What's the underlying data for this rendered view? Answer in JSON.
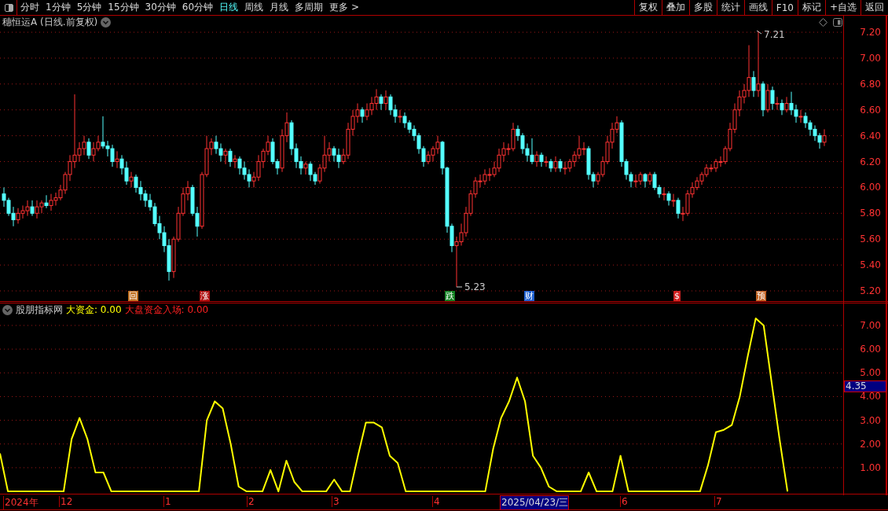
{
  "period_tabs": [
    {
      "label": "分时",
      "selected": false
    },
    {
      "label": "1分钟",
      "selected": false
    },
    {
      "label": "5分钟",
      "selected": false
    },
    {
      "label": "15分钟",
      "selected": false
    },
    {
      "label": "30分钟",
      "selected": false
    },
    {
      "label": "60分钟",
      "selected": false
    },
    {
      "label": "日线",
      "selected": true
    },
    {
      "label": "周线",
      "selected": false
    },
    {
      "label": "月线",
      "selected": false
    },
    {
      "label": "多周期",
      "selected": false
    },
    {
      "label": "更多 >",
      "selected": false
    }
  ],
  "toolbar_buttons": [
    "复权",
    "叠加",
    "多股",
    "统计",
    "画线",
    "F10",
    "标记",
    "+自选",
    "返回"
  ],
  "price_panel": {
    "title": "穗恒运A (日线.前复权)",
    "high_label": "7.21",
    "low_label": "5.23",
    "markers": [
      {
        "text": "回",
        "color": "#c07020"
      },
      {
        "text": "涨",
        "color": "#b01010"
      },
      {
        "text": "跌",
        "color": "#108020"
      },
      {
        "text": "财",
        "color": "#2060d0"
      },
      {
        "text": "$",
        "color": "#d02020"
      },
      {
        "text": "预",
        "color": "#c06020"
      }
    ],
    "chart_data": {
      "type": "candlestick",
      "grid": true,
      "ylim": [
        5.115,
        7.334
      ],
      "yticks": [
        {
          "value": 7.2,
          "label": "7.20"
        },
        {
          "value": 7.0,
          "label": "7.00"
        },
        {
          "value": 6.8,
          "label": "6.80"
        },
        {
          "value": 6.6,
          "label": "6.60"
        },
        {
          "value": 6.4,
          "label": "6.40"
        },
        {
          "value": 6.2,
          "label": "6.20"
        },
        {
          "value": 6.0,
          "label": "6.00"
        },
        {
          "value": 5.8,
          "label": "5.80"
        },
        {
          "value": 5.6,
          "label": "5.60"
        },
        {
          "value": 5.4,
          "label": "5.40"
        },
        {
          "value": 5.2,
          "label": "5.20"
        }
      ],
      "ohlc": [
        [
          5.95,
          6.0,
          5.85,
          5.9
        ],
        [
          5.9,
          5.92,
          5.78,
          5.8
        ],
        [
          5.8,
          5.85,
          5.7,
          5.75
        ],
        [
          5.75,
          5.84,
          5.72,
          5.8
        ],
        [
          5.8,
          5.86,
          5.76,
          5.82
        ],
        [
          5.82,
          5.9,
          5.78,
          5.85
        ],
        [
          5.85,
          5.9,
          5.78,
          5.8
        ],
        [
          5.8,
          5.9,
          5.76,
          5.85
        ],
        [
          5.85,
          5.9,
          5.8,
          5.88
        ],
        [
          5.88,
          5.94,
          5.84,
          5.86
        ],
        [
          5.86,
          5.95,
          5.82,
          5.9
        ],
        [
          5.9,
          5.96,
          5.86,
          5.92
        ],
        [
          5.92,
          6.02,
          5.9,
          5.98
        ],
        [
          5.98,
          6.12,
          5.95,
          6.1
        ],
        [
          6.1,
          6.25,
          6.05,
          6.2
        ],
        [
          6.2,
          6.72,
          6.15,
          6.25
        ],
        [
          6.25,
          6.35,
          6.2,
          6.3
        ],
        [
          6.3,
          6.4,
          6.25,
          6.35
        ],
        [
          6.35,
          6.38,
          6.22,
          6.25
        ],
        [
          6.25,
          6.35,
          6.2,
          6.3
        ],
        [
          6.3,
          6.4,
          6.28,
          6.35
        ],
        [
          6.35,
          6.55,
          6.3,
          6.32
        ],
        [
          6.32,
          6.36,
          6.24,
          6.3
        ],
        [
          6.3,
          6.33,
          6.16,
          6.2
        ],
        [
          6.2,
          6.28,
          6.15,
          6.22
        ],
        [
          6.22,
          6.25,
          6.1,
          6.15
        ],
        [
          6.15,
          6.2,
          6.02,
          6.05
        ],
        [
          6.05,
          6.12,
          6.0,
          6.08
        ],
        [
          6.08,
          6.1,
          5.96,
          6.0
        ],
        [
          6.0,
          6.05,
          5.9,
          5.95
        ],
        [
          5.95,
          5.98,
          5.85,
          5.9
        ],
        [
          5.9,
          5.95,
          5.82,
          5.85
        ],
        [
          5.85,
          5.88,
          5.7,
          5.72
        ],
        [
          5.72,
          5.78,
          5.6,
          5.65
        ],
        [
          5.65,
          5.7,
          5.5,
          5.55
        ],
        [
          5.55,
          5.6,
          5.28,
          5.35
        ],
        [
          5.35,
          5.62,
          5.3,
          5.6
        ],
        [
          5.6,
          5.85,
          5.58,
          5.8
        ],
        [
          5.8,
          6.0,
          5.78,
          5.95
        ],
        [
          5.95,
          6.05,
          5.9,
          6.0
        ],
        [
          6.0,
          6.02,
          5.78,
          5.8
        ],
        [
          5.8,
          5.85,
          5.62,
          5.7
        ],
        [
          5.7,
          6.12,
          5.68,
          6.1
        ],
        [
          6.1,
          6.4,
          6.08,
          6.3
        ],
        [
          6.3,
          6.38,
          6.25,
          6.35
        ],
        [
          6.35,
          6.4,
          6.26,
          6.3
        ],
        [
          6.3,
          6.34,
          6.2,
          6.25
        ],
        [
          6.25,
          6.3,
          6.18,
          6.28
        ],
        [
          6.28,
          6.3,
          6.16,
          6.2
        ],
        [
          6.2,
          6.25,
          6.15,
          6.22
        ],
        [
          6.22,
          6.24,
          6.1,
          6.15
        ],
        [
          6.15,
          6.2,
          6.06,
          6.1
        ],
        [
          6.1,
          6.14,
          6.0,
          6.05
        ],
        [
          6.05,
          6.12,
          6.0,
          6.08
        ],
        [
          6.08,
          6.25,
          6.05,
          6.2
        ],
        [
          6.2,
          6.3,
          6.15,
          6.28
        ],
        [
          6.28,
          6.4,
          6.25,
          6.35
        ],
        [
          6.35,
          6.38,
          6.18,
          6.2
        ],
        [
          6.2,
          6.22,
          6.1,
          6.15
        ],
        [
          6.15,
          6.45,
          6.12,
          6.4
        ],
        [
          6.4,
          6.58,
          6.35,
          6.5
        ],
        [
          6.5,
          6.52,
          6.25,
          6.3
        ],
        [
          6.3,
          6.34,
          6.15,
          6.2
        ],
        [
          6.2,
          6.24,
          6.1,
          6.15
        ],
        [
          6.15,
          6.2,
          6.1,
          6.18
        ],
        [
          6.18,
          6.2,
          6.05,
          6.1
        ],
        [
          6.1,
          6.12,
          6.02,
          6.05
        ],
        [
          6.05,
          6.18,
          6.03,
          6.15
        ],
        [
          6.15,
          6.4,
          6.12,
          6.25
        ],
        [
          6.25,
          6.35,
          6.2,
          6.3
        ],
        [
          6.3,
          6.32,
          6.2,
          6.25
        ],
        [
          6.25,
          6.3,
          6.15,
          6.2
        ],
        [
          6.2,
          6.3,
          6.18,
          6.25
        ],
        [
          6.25,
          6.5,
          6.22,
          6.45
        ],
        [
          6.45,
          6.6,
          6.4,
          6.55
        ],
        [
          6.55,
          6.65,
          6.5,
          6.6
        ],
        [
          6.6,
          6.62,
          6.5,
          6.55
        ],
        [
          6.55,
          6.65,
          6.52,
          6.6
        ],
        [
          6.6,
          6.7,
          6.56,
          6.65
        ],
        [
          6.65,
          6.76,
          6.6,
          6.7
        ],
        [
          6.7,
          6.72,
          6.6,
          6.65
        ],
        [
          6.65,
          6.75,
          6.6,
          6.7
        ],
        [
          6.7,
          6.72,
          6.56,
          6.6
        ],
        [
          6.6,
          6.64,
          6.5,
          6.55
        ],
        [
          6.55,
          6.6,
          6.5,
          6.55
        ],
        [
          6.55,
          6.58,
          6.46,
          6.5
        ],
        [
          6.5,
          6.52,
          6.42,
          6.45
        ],
        [
          6.45,
          6.48,
          6.36,
          6.4
        ],
        [
          6.4,
          6.42,
          6.26,
          6.3
        ],
        [
          6.3,
          6.32,
          6.16,
          6.2
        ],
        [
          6.2,
          6.28,
          6.18,
          6.25
        ],
        [
          6.25,
          6.32,
          6.2,
          6.3
        ],
        [
          6.3,
          6.4,
          6.26,
          6.35
        ],
        [
          6.35,
          6.36,
          6.1,
          6.15
        ],
        [
          6.15,
          6.16,
          5.65,
          5.7
        ],
        [
          5.7,
          5.72,
          5.5,
          5.55
        ],
        [
          5.55,
          5.62,
          5.23,
          5.58
        ],
        [
          5.58,
          5.72,
          5.55,
          5.65
        ],
        [
          5.65,
          5.85,
          5.62,
          5.8
        ],
        [
          5.8,
          5.98,
          5.78,
          5.95
        ],
        [
          5.95,
          6.08,
          5.92,
          6.05
        ],
        [
          6.05,
          6.1,
          6.0,
          6.05
        ],
        [
          6.05,
          6.14,
          6.02,
          6.1
        ],
        [
          6.1,
          6.15,
          6.05,
          6.1
        ],
        [
          6.1,
          6.2,
          6.08,
          6.15
        ],
        [
          6.15,
          6.3,
          6.12,
          6.25
        ],
        [
          6.25,
          6.35,
          6.2,
          6.3
        ],
        [
          6.3,
          6.34,
          6.25,
          6.3
        ],
        [
          6.3,
          6.5,
          6.28,
          6.45
        ],
        [
          6.45,
          6.48,
          6.36,
          6.4
        ],
        [
          6.4,
          6.42,
          6.26,
          6.3
        ],
        [
          6.3,
          6.34,
          6.2,
          6.25
        ],
        [
          6.25,
          6.38,
          6.18,
          6.2
        ],
        [
          6.2,
          6.28,
          6.16,
          6.25
        ],
        [
          6.25,
          6.27,
          6.16,
          6.2
        ],
        [
          6.2,
          6.24,
          6.16,
          6.2
        ],
        [
          6.2,
          6.22,
          6.12,
          6.15
        ],
        [
          6.15,
          6.24,
          6.12,
          6.2
        ],
        [
          6.2,
          6.22,
          6.12,
          6.15
        ],
        [
          6.15,
          6.2,
          6.1,
          6.15
        ],
        [
          6.15,
          6.22,
          6.12,
          6.2
        ],
        [
          6.2,
          6.28,
          6.16,
          6.25
        ],
        [
          6.25,
          6.4,
          6.22,
          6.3
        ],
        [
          6.3,
          6.35,
          6.25,
          6.3
        ],
        [
          6.3,
          6.32,
          6.06,
          6.1
        ],
        [
          6.1,
          6.12,
          6.0,
          6.05
        ],
        [
          6.05,
          6.12,
          6.02,
          6.1
        ],
        [
          6.1,
          6.24,
          6.08,
          6.2
        ],
        [
          6.2,
          6.4,
          6.18,
          6.35
        ],
        [
          6.35,
          6.5,
          6.3,
          6.45
        ],
        [
          6.45,
          6.55,
          6.42,
          6.5
        ],
        [
          6.5,
          6.52,
          6.16,
          6.2
        ],
        [
          6.2,
          6.22,
          6.06,
          6.1
        ],
        [
          6.1,
          6.12,
          6.0,
          6.05
        ],
        [
          6.05,
          6.1,
          6.0,
          6.05
        ],
        [
          6.05,
          6.12,
          6.02,
          6.1
        ],
        [
          6.1,
          6.11,
          6.0,
          6.05
        ],
        [
          6.05,
          6.12,
          6.02,
          6.1
        ],
        [
          6.1,
          6.12,
          5.98,
          6.0
        ],
        [
          6.0,
          6.02,
          5.92,
          5.95
        ],
        [
          5.95,
          6.0,
          5.9,
          5.95
        ],
        [
          5.95,
          5.97,
          5.86,
          5.9
        ],
        [
          5.9,
          5.95,
          5.85,
          5.9
        ],
        [
          5.9,
          5.92,
          5.76,
          5.8
        ],
        [
          5.8,
          5.85,
          5.74,
          5.8
        ],
        [
          5.8,
          5.98,
          5.78,
          5.95
        ],
        [
          5.95,
          6.04,
          5.92,
          6.0
        ],
        [
          6.0,
          6.08,
          5.98,
          6.05
        ],
        [
          6.05,
          6.12,
          6.02,
          6.1
        ],
        [
          6.1,
          6.18,
          6.08,
          6.15
        ],
        [
          6.15,
          6.18,
          6.12,
          6.15
        ],
        [
          6.15,
          6.22,
          6.12,
          6.2
        ],
        [
          6.2,
          6.24,
          6.16,
          6.2
        ],
        [
          6.2,
          6.32,
          6.18,
          6.3
        ],
        [
          6.3,
          6.5,
          6.28,
          6.45
        ],
        [
          6.45,
          6.65,
          6.42,
          6.6
        ],
        [
          6.6,
          6.75,
          6.55,
          6.7
        ],
        [
          6.7,
          6.8,
          6.65,
          6.75
        ],
        [
          6.75,
          7.1,
          6.7,
          6.85
        ],
        [
          6.85,
          6.9,
          6.7,
          6.75
        ],
        [
          6.75,
          7.21,
          6.7,
          6.8
        ],
        [
          6.8,
          6.82,
          6.55,
          6.6
        ],
        [
          6.6,
          6.8,
          6.58,
          6.75
        ],
        [
          6.75,
          6.78,
          6.6,
          6.65
        ],
        [
          6.65,
          6.7,
          6.6,
          6.65
        ],
        [
          6.65,
          6.68,
          6.56,
          6.6
        ],
        [
          6.6,
          6.7,
          6.58,
          6.65
        ],
        [
          6.65,
          6.74,
          6.56,
          6.6
        ],
        [
          6.6,
          6.64,
          6.5,
          6.55
        ],
        [
          6.55,
          6.6,
          6.5,
          6.55
        ],
        [
          6.55,
          6.58,
          6.46,
          6.5
        ],
        [
          6.5,
          6.52,
          6.4,
          6.45
        ],
        [
          6.45,
          6.48,
          6.36,
          6.4
        ],
        [
          6.4,
          6.42,
          6.3,
          6.35
        ],
        [
          6.35,
          6.45,
          6.32,
          6.4
        ]
      ]
    }
  },
  "indicator_panel": {
    "name": "股朋指标网",
    "legend": [
      {
        "value": "0.00",
        "color": "#ffff00"
      },
      {
        "label": "大盘资金入场:",
        "value": "0.00",
        "color": "#ff2020"
      }
    ],
    "current_value": "4.35",
    "chart_data": {
      "type": "line",
      "grid": true,
      "ylim": [
        -0.13,
        7.96
      ],
      "yticks": [
        {
          "value": 1,
          "label": "1.00"
        },
        {
          "value": 2,
          "label": "2.00"
        },
        {
          "value": 3,
          "label": "3.00"
        },
        {
          "value": 4,
          "label": "4.00"
        },
        {
          "value": 5,
          "label": "5.00"
        },
        {
          "value": 6,
          "label": "6.00"
        },
        {
          "value": 7,
          "label": "7.00"
        }
      ],
      "series": [
        {
          "name": "大资金:",
          "color": "#ffff00",
          "values": [
            1.6,
            0,
            0,
            0,
            0,
            0,
            0,
            0,
            0,
            2.2,
            3.1,
            2.2,
            0.8,
            0.8,
            0,
            0,
            0,
            0,
            0,
            0,
            0,
            0,
            0,
            0,
            0,
            0,
            3.0,
            3.8,
            3.5,
            2.0,
            0.2,
            0,
            0,
            0,
            0.9,
            0,
            1.3,
            0.4,
            0,
            0,
            0,
            0,
            0.5,
            0,
            0,
            1.5,
            2.9,
            2.9,
            2.7,
            1.5,
            1.2,
            0,
            0,
            0,
            0,
            0,
            0,
            0,
            0,
            0,
            0,
            0,
            1.8,
            3.1,
            3.8,
            4.8,
            3.8,
            1.5,
            1.0,
            0.2,
            0,
            0,
            0,
            0,
            0.8,
            0,
            0,
            0,
            1.5,
            0,
            0,
            0,
            0,
            0,
            0,
            0,
            0,
            0,
            0,
            1.1,
            2.5,
            2.6,
            2.8,
            4.0,
            5.7,
            7.3,
            7.0,
            4.6,
            2.2,
            0,
            null,
            null,
            null,
            null,
            null,
            null,
            null
          ]
        }
      ]
    }
  },
  "time_axis": [
    {
      "label": "2024年",
      "kind": "month"
    },
    {
      "label": "12",
      "kind": "month"
    },
    {
      "label": "1",
      "kind": "month"
    },
    {
      "label": "2",
      "kind": "month"
    },
    {
      "label": "3",
      "kind": "month"
    },
    {
      "label": "4",
      "kind": "month"
    },
    {
      "label": "2025/04/23/三",
      "kind": "cursor"
    },
    {
      "label": "6",
      "kind": "month"
    },
    {
      "label": "7",
      "kind": "month"
    }
  ]
}
